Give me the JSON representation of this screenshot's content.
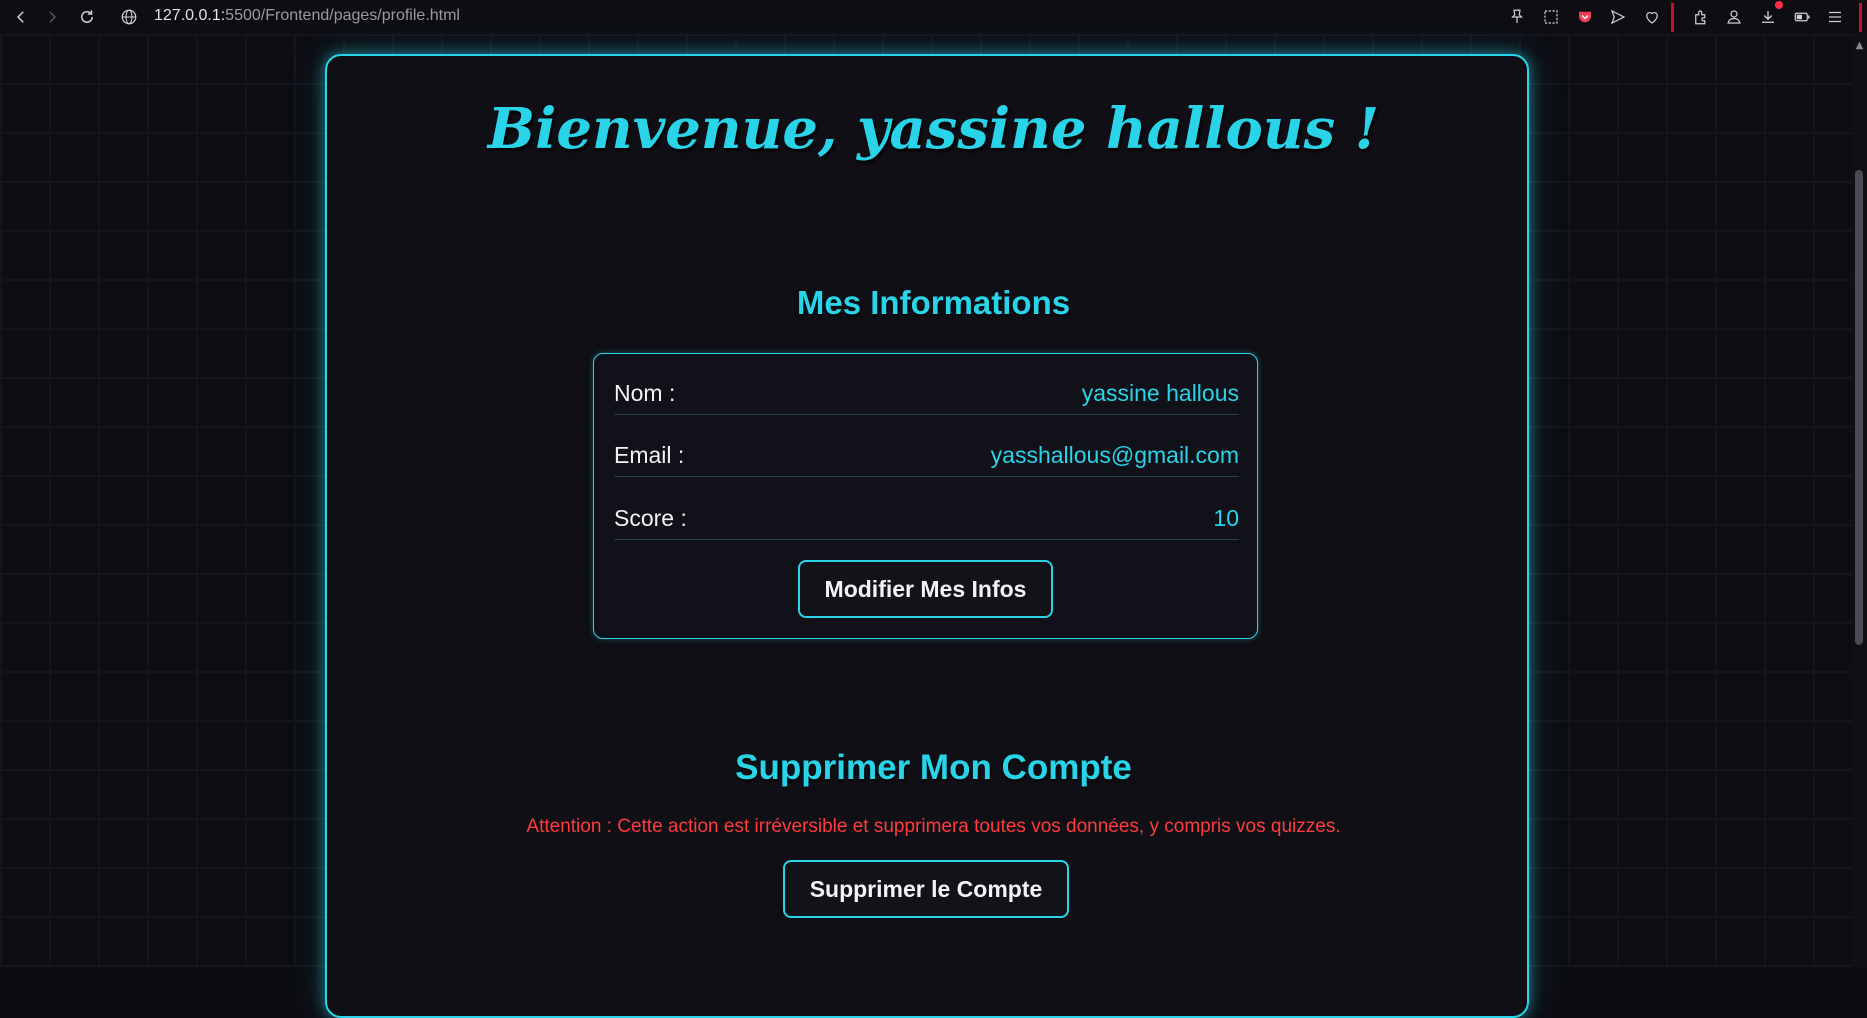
{
  "browser": {
    "url_host": "127.0.0.1:",
    "url_rest": "5500/Frontend/pages/profile.html"
  },
  "page": {
    "welcome": "Bienvenue, yassine hallous !",
    "info_section": {
      "title": "Mes Informations",
      "rows": [
        {
          "label": "Nom :",
          "value": "yassine hallous"
        },
        {
          "label": "Email :",
          "value": "yasshallous@gmail.com"
        },
        {
          "label": "Score :",
          "value": "10"
        }
      ],
      "modify_button": "Modifier Mes Infos"
    },
    "delete_section": {
      "title": "Supprimer Mon Compte",
      "warning": "Attention : Cette action est irréversible et supprimera toutes vos données, y compris vos quizzes.",
      "delete_button": "Supprimer le Compte"
    }
  },
  "colors": {
    "accent": "#2ad4e8",
    "warning": "#ff3b3b",
    "background": "#0d0d13"
  }
}
